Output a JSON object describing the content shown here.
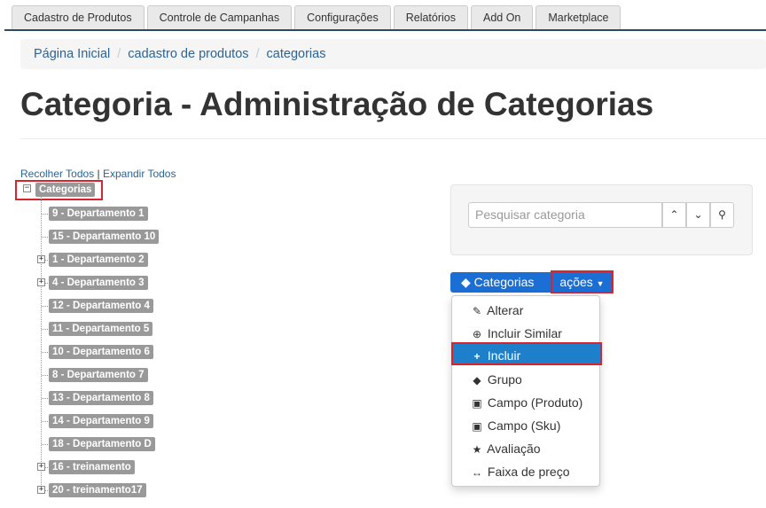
{
  "top_tabs": [
    "Cadastro de Produtos",
    "Controle de Campanhas",
    "Configurações",
    "Relatórios",
    "Add On",
    "Marketplace"
  ],
  "breadcrumb": [
    "Página Inicial",
    "cadastro de produtos",
    "categorias"
  ],
  "page_title": "Categoria - Administração de Categorias",
  "tree_links": {
    "collapse": "Recolher Todos",
    "separator": "|",
    "expand": "Expandir Todos"
  },
  "tree": {
    "root": "Categorias",
    "nodes": [
      {
        "label": "9 - Departamento 1",
        "expandable": false
      },
      {
        "label": "15 - Departamento 10",
        "expandable": false
      },
      {
        "label": "1 - Departamento 2",
        "expandable": true
      },
      {
        "label": "4 - Departamento 3",
        "expandable": true
      },
      {
        "label": "12 - Departamento 4",
        "expandable": false
      },
      {
        "label": "11 - Departamento 5",
        "expandable": false
      },
      {
        "label": "10 - Departamento 6",
        "expandable": false
      },
      {
        "label": "8 - Departamento 7",
        "expandable": false
      },
      {
        "label": "13 - Departamento 8",
        "expandable": false
      },
      {
        "label": "14 - Departamento 9",
        "expandable": false
      },
      {
        "label": "18 - Departamento D",
        "expandable": false
      },
      {
        "label": "16 - treinamento",
        "expandable": true
      },
      {
        "label": "20 - treinamento17",
        "expandable": true
      }
    ]
  },
  "search": {
    "placeholder": "Pesquisar categoria"
  },
  "categories_button": "Categorias",
  "actions_button": "ações",
  "actions_menu": [
    {
      "label": "Alterar",
      "icon": "pencil-icon"
    },
    {
      "label": "Incluir Similar",
      "icon": "plus-circle-icon"
    },
    {
      "label": "Incluir",
      "icon": "plus-icon",
      "active": true
    },
    {
      "label": "Grupo",
      "icon": "tags-icon"
    },
    {
      "label": "Campo (Produto)",
      "icon": "gift-icon"
    },
    {
      "label": "Campo (Sku)",
      "icon": "gift-icon"
    },
    {
      "label": "Avaliação",
      "icon": "star-icon"
    },
    {
      "label": "Faixa de preço",
      "icon": "resize-horizontal-icon"
    }
  ],
  "colors": {
    "accent": "#1b6ed3",
    "highlight": "#d9232d",
    "node_bg": "#999999"
  }
}
